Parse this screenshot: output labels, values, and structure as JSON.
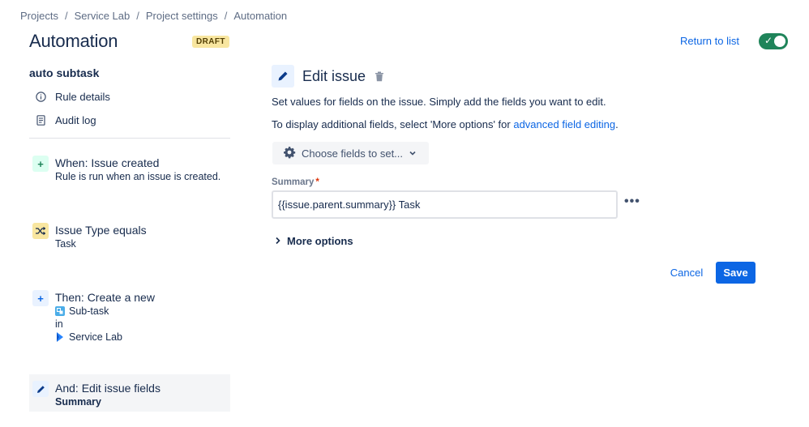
{
  "breadcrumb": [
    "Projects",
    "Service Lab",
    "Project settings",
    "Automation"
  ],
  "header": {
    "title": "Automation",
    "badge": "DRAFT",
    "return_link": "Return to list",
    "toggle_state": "on"
  },
  "sidebar": {
    "rule_name": "auto subtask",
    "links": [
      {
        "label": "Rule details",
        "icon": "info-icon"
      },
      {
        "label": "Audit log",
        "icon": "document-icon"
      }
    ],
    "steps": [
      {
        "title": "When: Issue created",
        "subtitle": "Rule is run when an issue is created.",
        "icon": "plus-icon"
      },
      {
        "title": "Issue Type equals",
        "subtitle": "Task",
        "icon": "shuffle-icon"
      },
      {
        "title": "Then: Create a new",
        "line1": "Sub-task",
        "line2": "in",
        "line3": "Service Lab",
        "icon": "plus-icon"
      },
      {
        "title": "And: Edit issue fields",
        "subtitle": "Summary",
        "icon": "pencil-icon"
      }
    ]
  },
  "panel": {
    "title": "Edit issue",
    "desc1": "Set values for fields on the issue. Simply add the fields you want to edit.",
    "desc2_prefix": "To display additional fields, select 'More options' for ",
    "desc2_link": "advanced field editing",
    "desc2_suffix": ".",
    "choose_button": "Choose fields to set...",
    "field_label": "Summary",
    "field_required": "*",
    "summary_value": "{{issue.parent.summary}} Task",
    "more_dots": "•••",
    "more_options": "More options",
    "cancel": "Cancel",
    "save": "Save"
  },
  "colors": {
    "accent": "#0c66e4",
    "toggle_on": "#1f845a",
    "badge_bg": "#f8e6a0"
  }
}
